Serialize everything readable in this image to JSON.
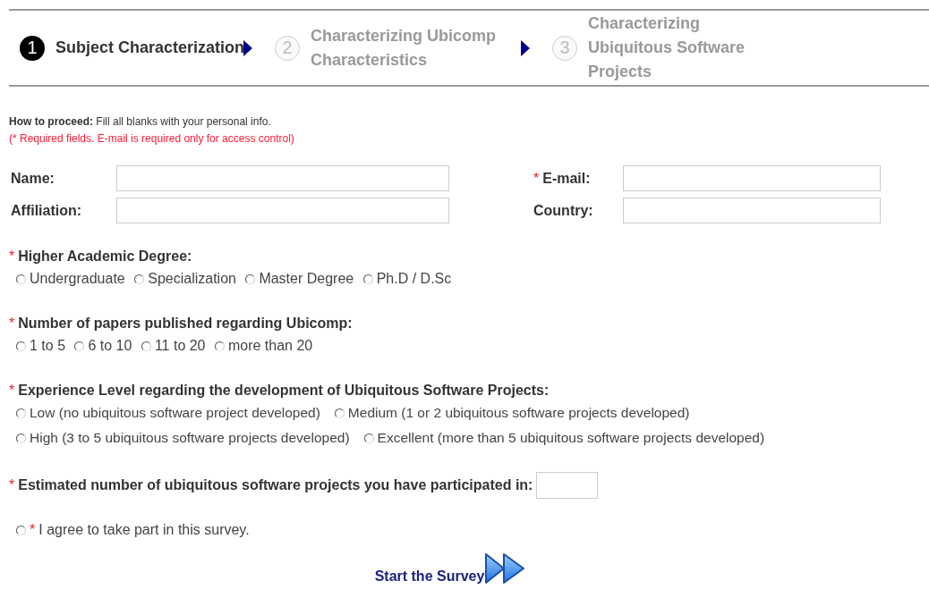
{
  "steps": [
    {
      "number": "1",
      "label": "Subject Characterization",
      "selected": true
    },
    {
      "number": "2",
      "label": "Characterizing Ubicomp Characteristics",
      "selected": false
    },
    {
      "number": "3",
      "label": "Characterizing Ubiquitous Software Projects",
      "selected": false
    }
  ],
  "intro": {
    "heading": "How to proceed:",
    "text": "Fill all blanks with your personal info.",
    "note": "(* Required fields. E-mail is required only for access control)"
  },
  "fields": [
    {
      "label": "Name:"
    },
    {
      "label": "E-mail:",
      "marker": "*"
    },
    {
      "label": "Affiliation:"
    },
    {
      "label": "Country:"
    }
  ],
  "questions": [
    {
      "marker": "*",
      "title": "Higher Academic Degree:",
      "options": [
        {
          "label": "Undergraduate",
          "selected": false
        },
        {
          "label": "Specialization",
          "selected": false
        },
        {
          "label": "Master Degree",
          "selected": false
        },
        {
          "label": "Ph.D / D.Sc",
          "selected": false
        }
      ]
    },
    {
      "marker": "*",
      "title": "Number of papers published regarding Ubicomp:",
      "options": [
        {
          "label": "1 to 5",
          "selected": false
        },
        {
          "label": "6 to 10",
          "selected": false
        },
        {
          "label": "11 to 20",
          "selected": false
        },
        {
          "label": "more than 20",
          "selected": false
        }
      ]
    },
    {
      "marker": "*",
      "title": "Experience Level regarding the development of Ubiquitous Software Projects:",
      "options": [
        {
          "label": "Low (no ubiquitous software project developed)",
          "selected": false
        },
        {
          "label": "Medium (1 or 2 ubiquitous software projects developed)",
          "selected": false
        },
        {
          "label": "High (3 to 5 ubiquitous software projects developed)",
          "selected": false
        },
        {
          "label": "Excellent (more than 5 ubiquitous software projects developed)",
          "selected": false
        }
      ]
    }
  ],
  "estimate": {
    "marker": "*",
    "label": "Estimated number of ubiquitous software projects you have participated in:"
  },
  "agree": {
    "marker": "*",
    "label": "I agree to take part in this survey.",
    "selected": false
  },
  "start": {
    "label": "Start the Survey"
  }
}
